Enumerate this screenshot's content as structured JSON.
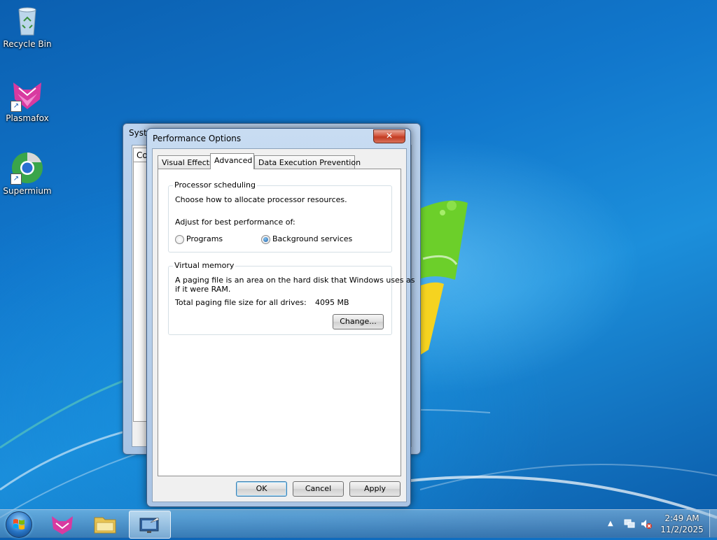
{
  "desktop": {
    "icons": [
      {
        "label": "Recycle Bin",
        "icon": "recycle-bin-icon"
      },
      {
        "label": "Plasmafox",
        "icon": "plasmafox-icon"
      },
      {
        "label": "Supermium",
        "icon": "supermium-icon"
      }
    ]
  },
  "background_window": {
    "title": "Syste",
    "tab_label": "Co"
  },
  "dialog": {
    "title": "Performance Options",
    "close_label": "✕",
    "tabs": [
      {
        "label": "Visual Effects"
      },
      {
        "label": "Advanced",
        "active": true
      },
      {
        "label": "Data Execution Prevention"
      }
    ],
    "processor": {
      "group_label": "Processor scheduling",
      "description": "Choose how to allocate processor resources.",
      "adjust_label": "Adjust for best performance of:",
      "option_programs": "Programs",
      "option_background": "Background services",
      "selected": "Background services"
    },
    "virtual_memory": {
      "group_label": "Virtual memory",
      "description_line1": "A paging file is an area on the hard disk that Windows uses as",
      "description_line2": "if it were RAM.",
      "total_label": "Total paging file size for all drives:",
      "total_value": "4095 MB",
      "change_button": "Change..."
    },
    "buttons": {
      "ok": "OK",
      "cancel": "Cancel",
      "apply": "Apply"
    }
  },
  "taskbar": {
    "pinned": [
      {
        "name": "plasmafox",
        "icon": "plasmafox-icon"
      },
      {
        "name": "explorer",
        "icon": "folder-icon"
      },
      {
        "name": "system-properties",
        "icon": "system-properties-icon",
        "active": true
      }
    ],
    "tray": {
      "time": "2:49 AM",
      "date": "11/2/2025",
      "icons": [
        "show-hidden-icons-arrow",
        "network-icon",
        "volume-muted-icon"
      ]
    }
  },
  "colors": {
    "desktop_blue": "#1177cc",
    "close_red": "#c23b22",
    "radio_blue": "#1d5fa8"
  }
}
